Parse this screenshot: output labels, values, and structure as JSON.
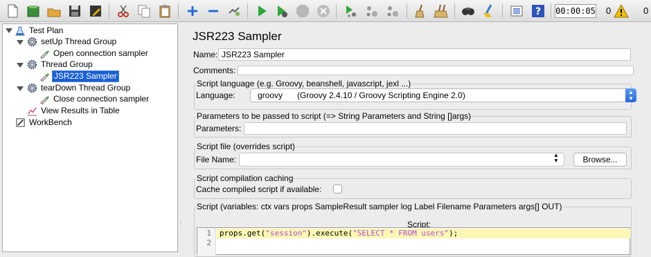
{
  "toolbar": {
    "buttons": [
      "new-icon",
      "templates-icon",
      "open-icon",
      "save-icon",
      "save-as-icon",
      "cut-icon",
      "copy-icon",
      "paste-icon",
      "expand-icon",
      "collapse-icon",
      "toggle-icon",
      "start-icon",
      "start-no-pause-icon",
      "stop-icon",
      "shutdown-icon",
      "remote-start-icon",
      "remote-stop-icon",
      "remote-shutdown-icon",
      "clear-icon",
      "clear-all-icon",
      "search-icon",
      "reset-search-icon",
      "function-helper-icon",
      "help-icon"
    ],
    "timer": "00:00:05",
    "active_threads": "0",
    "error_count": "0",
    "warning_color": "#f2c200"
  },
  "tree": {
    "items": [
      {
        "label": "Test Plan",
        "icon": "flask-icon"
      },
      {
        "label": "setUp Thread Group",
        "icon": "gear-icon"
      },
      {
        "label": "Open connection sampler",
        "icon": "pipette-icon"
      },
      {
        "label": "Thread Group",
        "icon": "gear-icon"
      },
      {
        "label": "JSR223 Sampler",
        "icon": "pipette-icon",
        "selected": true
      },
      {
        "label": "tearDown Thread Group",
        "icon": "gear-icon"
      },
      {
        "label": "Close connection sampler",
        "icon": "pipette-icon"
      },
      {
        "label": "View Results in Table",
        "icon": "chart-icon"
      },
      {
        "label": "WorkBench",
        "icon": "workbench-icon"
      }
    ],
    "selection_color": "#1a5fd0"
  },
  "sampler": {
    "title": "JSR223 Sampler",
    "name_label": "Name:",
    "name_value": "JSR223 Sampler",
    "comments_label": "Comments:",
    "comments_value": "",
    "language_section": "Script language (e.g. Groovy, beanshell, javascript, jexl ...)",
    "language_label": "Language:",
    "language_value": "groovy",
    "language_desc": "(Groovy 2.4.10 / Groovy Scripting Engine 2.0)",
    "params_section": "Parameters to be passed to script (=> String Parameters and String []args)",
    "params_label": "Parameters:",
    "params_value": "",
    "file_section": "Script file (overrides script)",
    "file_label": "File Name:",
    "file_value": "",
    "browse_label": "Browse...",
    "cache_section": "Script compilation caching",
    "cache_label": "Cache compiled script if available:",
    "cache_checked": false,
    "script_section": "Script (variables: ctx vars props SampleResult sampler log Label Filename Parameters args[] OUT)",
    "script_label": "Script:",
    "code_lines": [
      {
        "num": "1",
        "parts": [
          "props.get(",
          "\"session\"",
          ").execute(",
          "\"SELECT * FROM users\"",
          ");"
        ]
      },
      {
        "num": "2",
        "parts": [
          "",
          "",
          "",
          "",
          ""
        ]
      }
    ]
  }
}
